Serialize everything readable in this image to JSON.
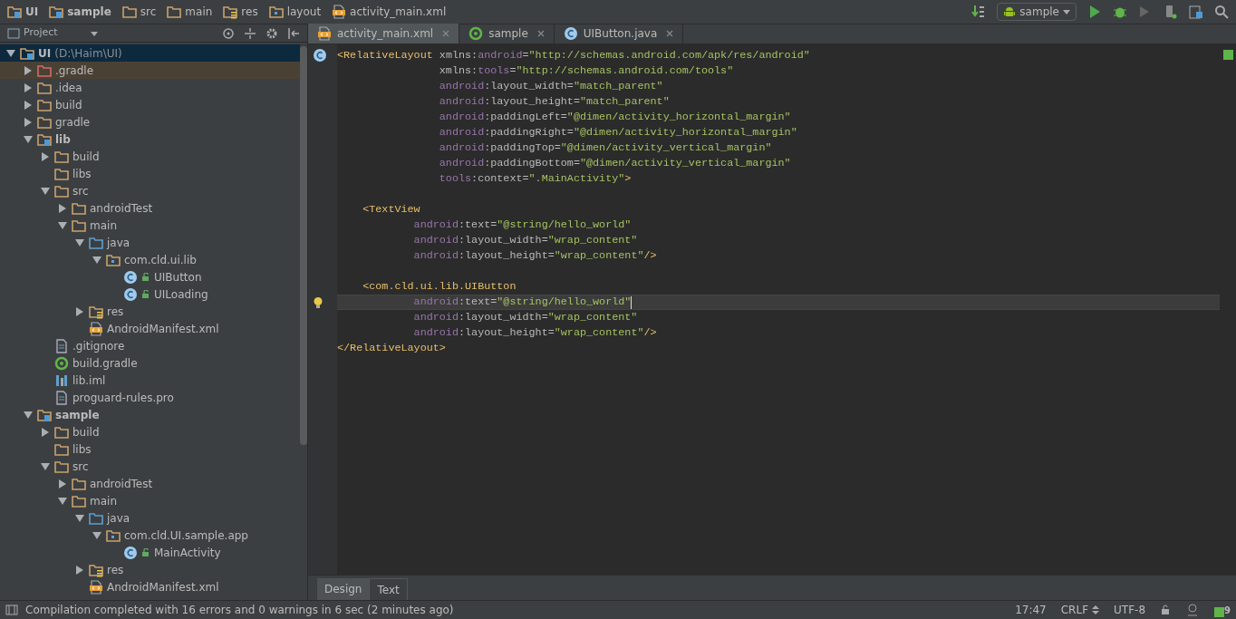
{
  "breadcrumb": [
    {
      "label": "UI",
      "kind": "module",
      "bold": true
    },
    {
      "label": "sample",
      "kind": "module",
      "bold": true
    },
    {
      "label": "src",
      "kind": "folder",
      "bold": false
    },
    {
      "label": "main",
      "kind": "folder",
      "bold": false
    },
    {
      "label": "res",
      "kind": "res",
      "bold": false
    },
    {
      "label": "layout",
      "kind": "package",
      "bold": false
    },
    {
      "label": "activity_main.xml",
      "kind": "xml",
      "bold": false
    }
  ],
  "run_config": {
    "label": "sample"
  },
  "project_panel": {
    "title": "Project",
    "tree": [
      {
        "label": "UI",
        "path": "(D:\\Haim\\UI)",
        "kind": "module",
        "expanded": true,
        "selected": true,
        "children": [
          {
            "label": ".gradle",
            "kind": "excluded",
            "expanded": false,
            "selected": false
          },
          {
            "label": ".idea",
            "kind": "folder",
            "expanded": false,
            "selected": false
          },
          {
            "label": "build",
            "kind": "folder",
            "expanded": false,
            "selected": false
          },
          {
            "label": "gradle",
            "kind": "folder",
            "expanded": false,
            "selected": false
          },
          {
            "label": "lib",
            "kind": "module",
            "expanded": true,
            "selected": false,
            "children": [
              {
                "label": "build",
                "kind": "folder",
                "expanded": false,
                "selected": false
              },
              {
                "label": "libs",
                "kind": "folder",
                "selected": false
              },
              {
                "label": "src",
                "kind": "folder",
                "expanded": true,
                "selected": false,
                "children": [
                  {
                    "label": "androidTest",
                    "kind": "folder",
                    "expanded": false,
                    "selected": false
                  },
                  {
                    "label": "main",
                    "kind": "folder",
                    "expanded": true,
                    "selected": false,
                    "children": [
                      {
                        "label": "java",
                        "kind": "source",
                        "expanded": true,
                        "selected": false,
                        "children": [
                          {
                            "label": "com.cld.ui.lib",
                            "kind": "package",
                            "expanded": true,
                            "selected": false,
                            "children": [
                              {
                                "label": "UIButton",
                                "kind": "class",
                                "selected": false
                              },
                              {
                                "label": "UILoading",
                                "kind": "class",
                                "selected": false
                              }
                            ]
                          }
                        ]
                      },
                      {
                        "label": "res",
                        "kind": "res",
                        "expanded": false,
                        "selected": false
                      },
                      {
                        "label": "AndroidManifest.xml",
                        "kind": "xml",
                        "selected": false
                      }
                    ]
                  }
                ]
              },
              {
                "label": ".gitignore",
                "kind": "file",
                "selected": false
              },
              {
                "label": "build.gradle",
                "kind": "gradle",
                "selected": false
              },
              {
                "label": "lib.iml",
                "kind": "iml",
                "selected": false
              },
              {
                "label": "proguard-rules.pro",
                "kind": "file",
                "selected": false
              }
            ]
          },
          {
            "label": "sample",
            "kind": "module",
            "expanded": true,
            "selected": false,
            "children": [
              {
                "label": "build",
                "kind": "folder",
                "expanded": false,
                "selected": false
              },
              {
                "label": "libs",
                "kind": "folder",
                "selected": false
              },
              {
                "label": "src",
                "kind": "folder",
                "expanded": true,
                "selected": false,
                "children": [
                  {
                    "label": "androidTest",
                    "kind": "folder",
                    "expanded": false,
                    "selected": false
                  },
                  {
                    "label": "main",
                    "kind": "folder",
                    "expanded": true,
                    "selected": false,
                    "children": [
                      {
                        "label": "java",
                        "kind": "source",
                        "expanded": true,
                        "selected": false,
                        "children": [
                          {
                            "label": "com.cld.UI.sample.app",
                            "kind": "package",
                            "expanded": true,
                            "selected": false,
                            "children": [
                              {
                                "label": "MainActivity",
                                "kind": "class",
                                "selected": false
                              }
                            ]
                          }
                        ]
                      },
                      {
                        "label": "res",
                        "kind": "res",
                        "expanded": false,
                        "selected": false
                      },
                      {
                        "label": "AndroidManifest.xml",
                        "kind": "xml",
                        "selected": false
                      }
                    ]
                  }
                ]
              }
            ]
          }
        ]
      }
    ]
  },
  "editor_tabs": [
    {
      "label": "activity_main.xml",
      "kind": "xml",
      "selected": true
    },
    {
      "label": "sample",
      "kind": "gradle",
      "selected": false
    },
    {
      "label": "UIButton.java",
      "kind": "class",
      "selected": false
    }
  ],
  "code_lines": [
    {
      "current": false,
      "segments": [
        {
          "kind": "tag",
          "s": "<RelativeLayout "
        },
        {
          "kind": "attr",
          "s": "xmlns:"
        },
        {
          "kind": "ns",
          "s": "android"
        },
        {
          "kind": "attr",
          "s": "="
        },
        {
          "kind": "value",
          "s": "\"http://schemas.android.com/apk/res/android\""
        }
      ]
    },
    {
      "current": false,
      "segments": [
        {
          "kind": "attr",
          "s": "                xmlns:"
        },
        {
          "kind": "ns",
          "s": "tools"
        },
        {
          "kind": "attr",
          "s": "="
        },
        {
          "kind": "value",
          "s": "\"http://schemas.android.com/tools\""
        }
      ]
    },
    {
      "current": false,
      "segments": [
        {
          "kind": "ns",
          "s": "                android"
        },
        {
          "kind": "attr",
          "s": ":layout_width="
        },
        {
          "kind": "value",
          "s": "\"match_parent\""
        }
      ]
    },
    {
      "current": false,
      "segments": [
        {
          "kind": "ns",
          "s": "                android"
        },
        {
          "kind": "attr",
          "s": ":layout_height="
        },
        {
          "kind": "value",
          "s": "\"match_parent\""
        }
      ]
    },
    {
      "current": false,
      "segments": [
        {
          "kind": "ns",
          "s": "                android"
        },
        {
          "kind": "attr",
          "s": ":paddingLeft="
        },
        {
          "kind": "value",
          "s": "\"@dimen/activity_horizontal_margin\""
        }
      ]
    },
    {
      "current": false,
      "segments": [
        {
          "kind": "ns",
          "s": "                android"
        },
        {
          "kind": "attr",
          "s": ":paddingRight="
        },
        {
          "kind": "value",
          "s": "\"@dimen/activity_horizontal_margin\""
        }
      ]
    },
    {
      "current": false,
      "segments": [
        {
          "kind": "ns",
          "s": "                android"
        },
        {
          "kind": "attr",
          "s": ":paddingTop="
        },
        {
          "kind": "value",
          "s": "\"@dimen/activity_vertical_margin\""
        }
      ]
    },
    {
      "current": false,
      "segments": [
        {
          "kind": "ns",
          "s": "                android"
        },
        {
          "kind": "attr",
          "s": ":paddingBottom="
        },
        {
          "kind": "value",
          "s": "\"@dimen/activity_vertical_margin\""
        }
      ]
    },
    {
      "current": false,
      "segments": [
        {
          "kind": "ns",
          "s": "                tools"
        },
        {
          "kind": "attr",
          "s": ":context="
        },
        {
          "kind": "value",
          "s": "\".MainActivity\""
        },
        {
          "kind": "tag",
          "s": ">"
        }
      ]
    },
    {
      "current": false,
      "blank_before": true,
      "segments": [
        {
          "kind": "tag",
          "s": "    <TextView"
        }
      ]
    },
    {
      "current": false,
      "segments": [
        {
          "kind": "ns",
          "s": "            android"
        },
        {
          "kind": "attr",
          "s": ":text="
        },
        {
          "kind": "value",
          "s": "\"@string/hello_world\""
        }
      ]
    },
    {
      "current": false,
      "segments": [
        {
          "kind": "ns",
          "s": "            android"
        },
        {
          "kind": "attr",
          "s": ":layout_width="
        },
        {
          "kind": "value",
          "s": "\"wrap_content\""
        }
      ]
    },
    {
      "current": false,
      "segments": [
        {
          "kind": "ns",
          "s": "            android"
        },
        {
          "kind": "attr",
          "s": ":layout_height="
        },
        {
          "kind": "value",
          "s": "\"wrap_content\""
        },
        {
          "kind": "tag",
          "s": "/>"
        }
      ]
    },
    {
      "current": false,
      "blank_before": true,
      "segments": [
        {
          "kind": "tag",
          "s": "    <com.cld.ui.lib.UIButton"
        }
      ]
    },
    {
      "current": true,
      "segments": [
        {
          "kind": "ns",
          "s": "            android"
        },
        {
          "kind": "attr",
          "s": ":text="
        },
        {
          "kind": "value",
          "s": "\"@string/hello_world\""
        }
      ]
    },
    {
      "current": false,
      "segments": [
        {
          "kind": "ns",
          "s": "            android"
        },
        {
          "kind": "attr",
          "s": ":layout_width="
        },
        {
          "kind": "value",
          "s": "\"wrap_content\""
        }
      ]
    },
    {
      "current": false,
      "segments": [
        {
          "kind": "ns",
          "s": "            android"
        },
        {
          "kind": "attr",
          "s": ":layout_height="
        },
        {
          "kind": "value",
          "s": "\"wrap_content\""
        },
        {
          "kind": "tag",
          "s": "/>"
        }
      ]
    },
    {
      "current": false,
      "segments": [
        {
          "kind": "tag",
          "s": "</RelativeLayout>"
        }
      ]
    }
  ],
  "editor_mode_tabs": [
    {
      "label": "Design",
      "selected": false
    },
    {
      "label": "Text",
      "selected": true
    }
  ],
  "status_bar": {
    "message": "Compilation completed with 16 errors and 0 warnings in 6 sec (2 minutes ago)",
    "position": "17:47",
    "line_separator": "CRLF",
    "encoding": "UTF-8",
    "event_count": "9"
  }
}
